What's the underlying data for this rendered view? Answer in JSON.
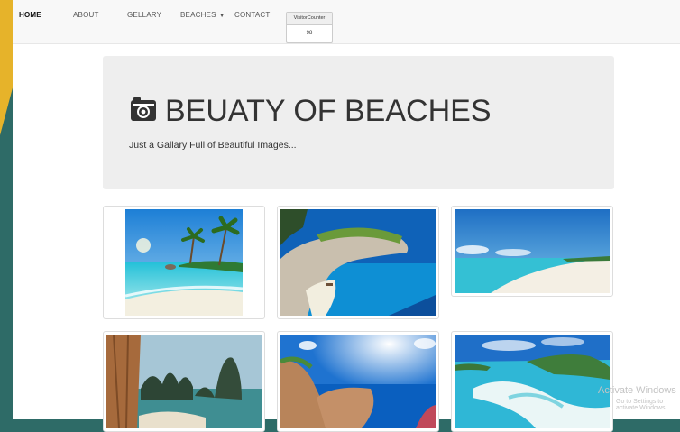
{
  "nav": {
    "items": [
      "HOME",
      "ABOUT",
      "GELLARY",
      "BEACHES",
      "CONTACT"
    ],
    "counter_label": "VisitorCounter",
    "counter_value": "98"
  },
  "hero": {
    "title": "BEUATY OF BEACHES",
    "subtitle": "Just a Gallary Full of Beautiful Images..."
  },
  "watermark": {
    "line1": "Activate Windows",
    "line2": "Go to Settings to activate Windows."
  },
  "colors": {
    "accent": "#e6b32a",
    "background": "#2e6b67"
  },
  "icons": [
    "camera-icon",
    "caret-down-icon"
  ]
}
